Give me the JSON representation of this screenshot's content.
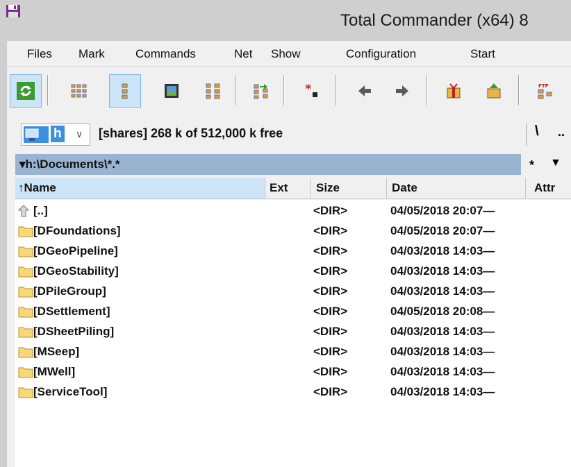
{
  "window": {
    "title": "Total Commander (x64) 8"
  },
  "menu": [
    "Files",
    "Mark",
    "Commands",
    "Net",
    "Show",
    "Configuration",
    "Start"
  ],
  "toolbar": {
    "buttons": [
      "refresh-icon",
      "brief-view-icon",
      "detailed-view-icon",
      "thumbnails-icon",
      "tree-view-icon",
      "compare-dirs-icon",
      "change-attributes-icon",
      "back-icon",
      "forward-icon",
      "pack-icon",
      "unpack-icon",
      "ftp-connect-icon"
    ],
    "active": "detailed-view-icon"
  },
  "drive": {
    "letter": "h",
    "info": "[shares]  268 k of 512,000 k free",
    "root_button": "\\",
    "up_button": ".."
  },
  "path": {
    "text": "▾h:\\Documents\\*.*",
    "filter": "*"
  },
  "columns": {
    "name": "↑Name",
    "ext": "Ext",
    "size": "Size",
    "date": "Date",
    "attr": "Attr"
  },
  "files": [
    {
      "name": "[..]",
      "size": "<DIR>",
      "date": "04/05/2018 20:07—",
      "type": "parent"
    },
    {
      "name": "[DFoundations]",
      "size": "<DIR>",
      "date": "04/05/2018 20:07—",
      "type": "folder"
    },
    {
      "name": "[DGeoPipeline]",
      "size": "<DIR>",
      "date": "04/03/2018 14:03—",
      "type": "folder"
    },
    {
      "name": "[DGeoStability]",
      "size": "<DIR>",
      "date": "04/03/2018 14:03—",
      "type": "folder"
    },
    {
      "name": "[DPileGroup]",
      "size": "<DIR>",
      "date": "04/03/2018 14:03—",
      "type": "folder"
    },
    {
      "name": "[DSettlement]",
      "size": "<DIR>",
      "date": "04/05/2018 20:08—",
      "type": "folder"
    },
    {
      "name": "[DSheetPiling]",
      "size": "<DIR>",
      "date": "04/03/2018 14:03—",
      "type": "folder"
    },
    {
      "name": "[MSeep]",
      "size": "<DIR>",
      "date": "04/03/2018 14:03—",
      "type": "folder"
    },
    {
      "name": "[MWell]",
      "size": "<DIR>",
      "date": "04/03/2018 14:03—",
      "type": "folder"
    },
    {
      "name": "[ServiceTool]",
      "size": "<DIR>",
      "date": "04/03/2018 14:03—",
      "type": "folder"
    }
  ],
  "colors": {
    "path_bar": "#99b4d1",
    "selected_header": "#cde3f7",
    "folder": "#f8d775"
  }
}
